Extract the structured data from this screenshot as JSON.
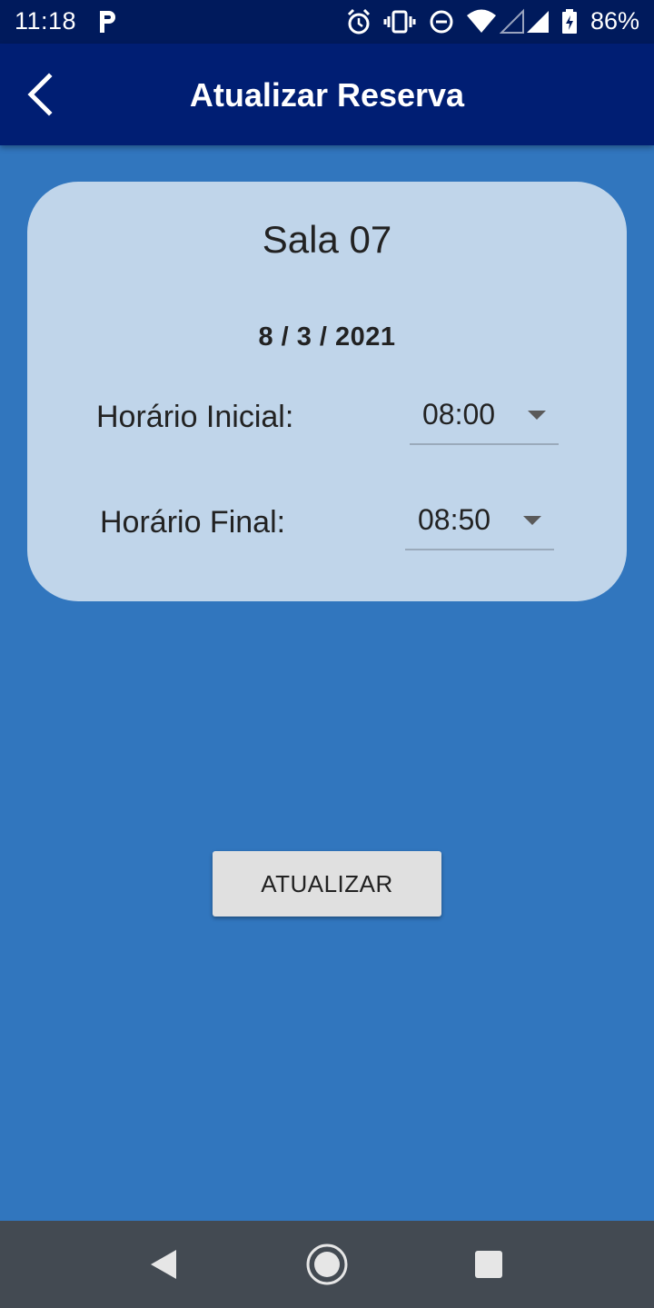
{
  "status_bar": {
    "time": "11:18",
    "battery_percent": "86%",
    "icons": [
      "parking-icon",
      "alarm-icon",
      "vibrate-icon",
      "dnd-icon",
      "wifi-icon",
      "signal-icon",
      "battery-charging-icon"
    ]
  },
  "app_bar": {
    "title": "Atualizar Reserva",
    "back_icon": "chevron-left-icon"
  },
  "card": {
    "room": "Sala 07",
    "date": "8 / 3 / 2021",
    "start": {
      "label": "Horário Inicial:",
      "value": "08:00"
    },
    "end": {
      "label": "Horário Final:",
      "value": "08:50"
    }
  },
  "actions": {
    "update_label": "ATUALIZAR"
  },
  "nav_bar": {
    "buttons": [
      "back-triangle-icon",
      "home-circle-icon",
      "recents-square-icon"
    ]
  },
  "colors": {
    "background": "#3176be",
    "app_bar": "#001e73",
    "status_bar": "#001a5c",
    "card": "#c0d5ea",
    "button": "#e0e0e0",
    "nav_bar": "#434a52"
  }
}
